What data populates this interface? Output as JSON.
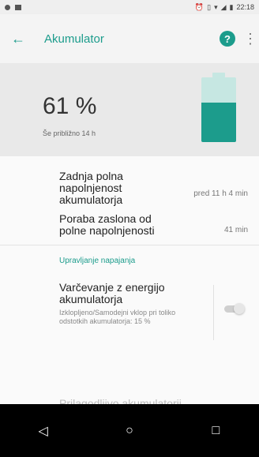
{
  "status_bar": {
    "left_icons": [
      "notification-icon",
      "notification-icon-2"
    ],
    "right_icons": [
      "alarm-icon",
      "vibrate-icon",
      "wifi-icon",
      "signal-icon",
      "battery-icon"
    ],
    "time": "22:18"
  },
  "app_bar": {
    "title": "Akumulator",
    "help_label": "?",
    "more_label": "⋮",
    "back_label": "←"
  },
  "battery": {
    "percent_text": "61 %",
    "status_text": "Še približno 14 h",
    "level": 0.61,
    "color": "#1c9c8c",
    "color_empty": "#c6e7e2"
  },
  "rows": [
    {
      "label": "Zadnja polna napolnjenost akumulatorja",
      "value": "pred 11 h 4 min"
    },
    {
      "label": "Poraba zaslona od polne napolnjenosti",
      "value": "41 min"
    }
  ],
  "section": {
    "title": "Upravljanje napajanja"
  },
  "power_saving": {
    "label": "Varčevanje z energijo akumulatorja",
    "description": "Izklopljeno/Samodejni vklop pri toliko odstotkih akumulatorja: 15 %",
    "enabled": false
  },
  "next_row": {
    "label": "Prilagodljivo akumulatorji"
  },
  "nav_bar": {
    "back_label": "◁",
    "home_label": "○",
    "recent_label": "□"
  }
}
